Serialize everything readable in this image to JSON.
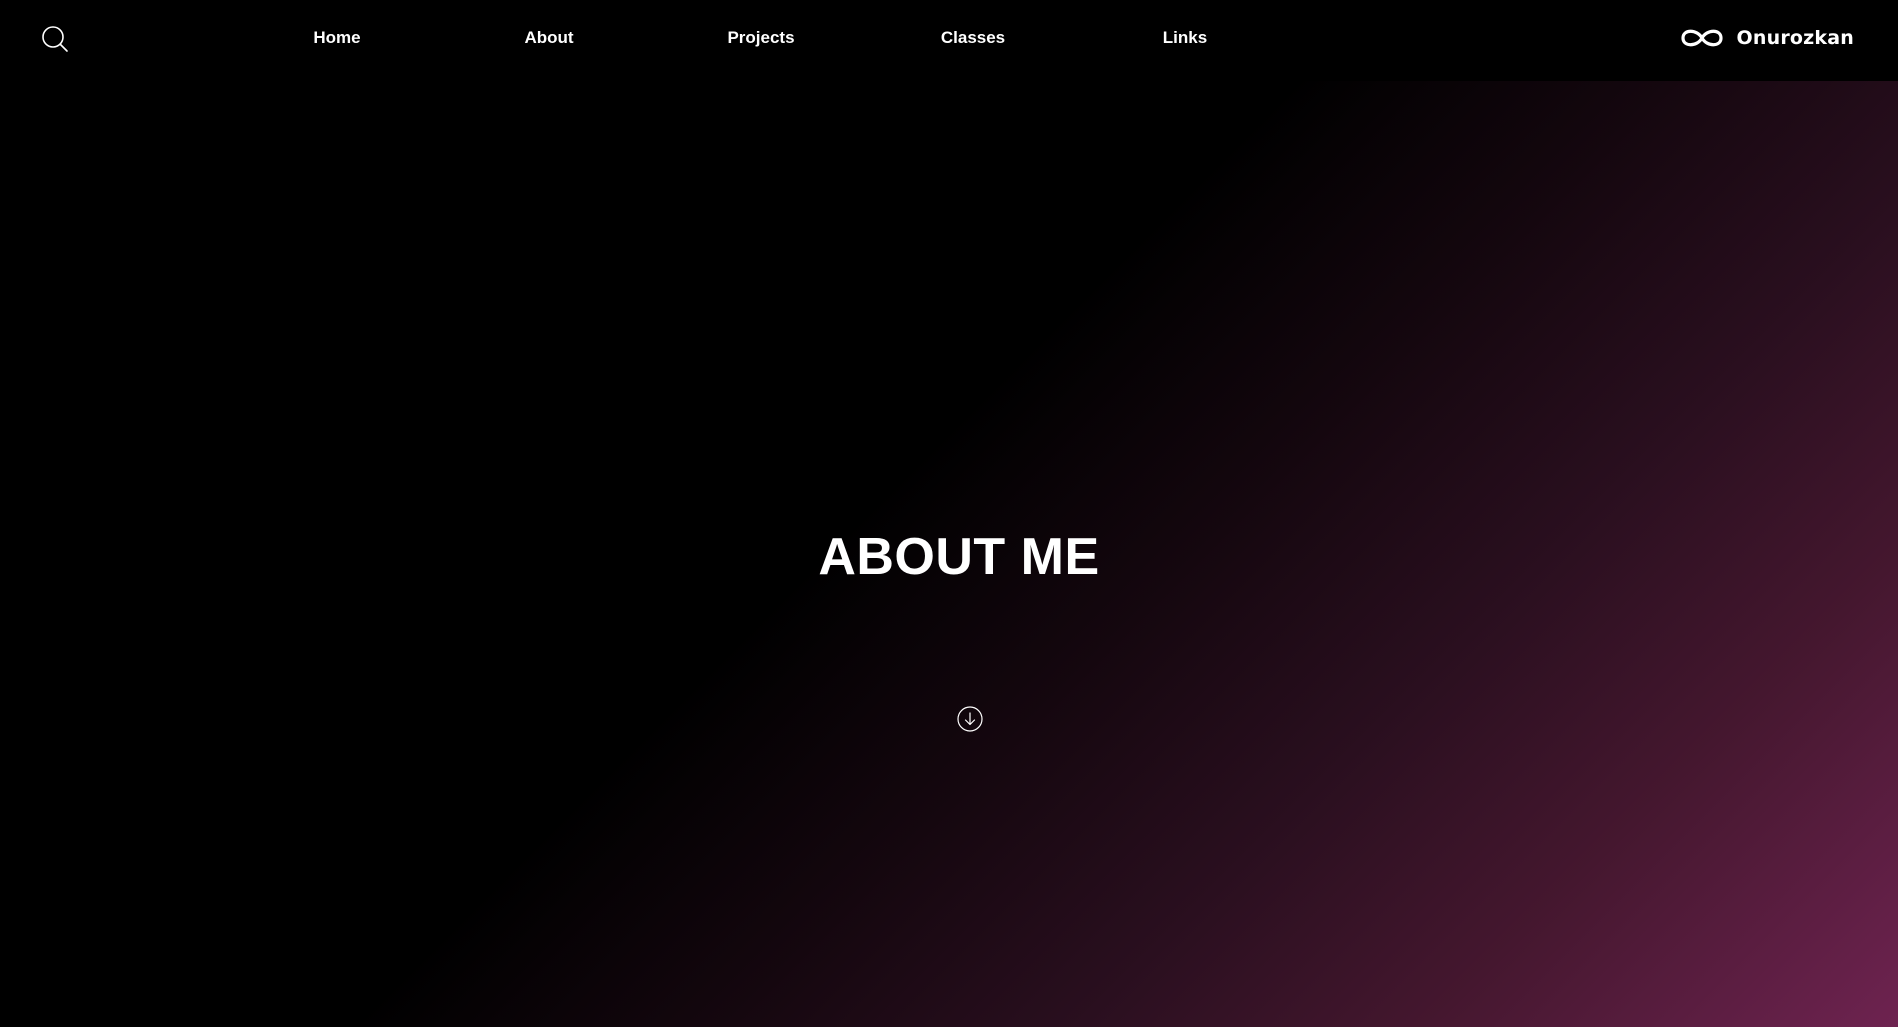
{
  "header": {
    "search_icon": "search-icon",
    "nav": [
      {
        "label": "Home"
      },
      {
        "label": "About"
      },
      {
        "label": "Projects"
      },
      {
        "label": "Classes"
      },
      {
        "label": "Links"
      }
    ],
    "brand": {
      "logo_icon": "infinity-icon",
      "name": "Onurozkan"
    }
  },
  "hero": {
    "title": "ABOUT ME",
    "scroll_icon": "arrow-down-circle-icon"
  },
  "colors": {
    "background": "#000000",
    "gradient_accent": "#6e2350",
    "text": "#ffffff"
  }
}
